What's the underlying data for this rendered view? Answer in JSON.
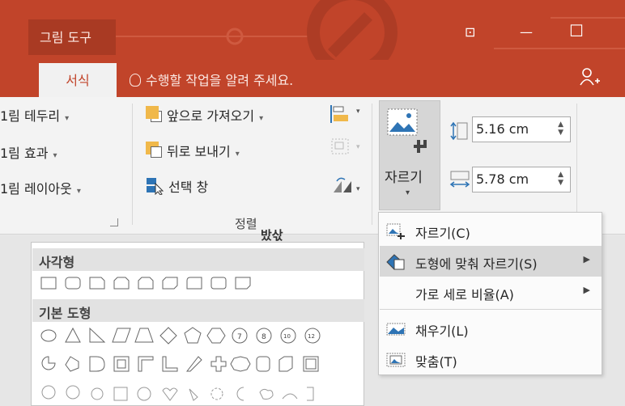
{
  "title_bar": {
    "tool_label": "그림 도구",
    "restore_glyph": "⊡",
    "minimize_glyph": "—",
    "maximize_glyph": "☐"
  },
  "tabs": {
    "active": "서식",
    "tell_me": "수행할 작업을 알려 주세요."
  },
  "ribbon": {
    "left_col": [
      "1림 테두리",
      "1림 효과",
      "1림 레이아웃"
    ],
    "arrange": {
      "bring_forward": "앞으로 가져오기",
      "send_backward": "뒤로 보내기",
      "selection_pane": "선택 창",
      "group_label": "정렬"
    },
    "crop_button": "자르기",
    "height_value": "5.16 cm",
    "width_value": "5.78 cm",
    "dropdown_glyph": "▾"
  },
  "peek_text": "밨삯",
  "gallery": {
    "headers": [
      "사각형",
      "기본 도형"
    ],
    "rect_count": 9,
    "basic_row1_labels": [
      "7",
      "8",
      "10",
      "12"
    ]
  },
  "menu": {
    "items": [
      {
        "label": "자르기(C)",
        "icon": "crop-icon",
        "submenu": false
      },
      {
        "label": "도형에 맞춰 자르기(S)",
        "icon": "crop-to-shape-icon",
        "submenu": true
      },
      {
        "label": "가로 세로 비율(A)",
        "icon": "",
        "submenu": true
      },
      {
        "label": "채우기(L)",
        "icon": "fill-icon",
        "submenu": false
      },
      {
        "label": "맞춤(T)",
        "icon": "fit-icon",
        "submenu": false
      }
    ],
    "submenu_glyph": "▶"
  },
  "colors": {
    "accent": "#c1442a",
    "accent_dark": "#a93a23",
    "ribbon_bg": "#f3f3f3",
    "menu_highlight": "#d8d8d8",
    "icon_blue": "#2e74b5",
    "icon_orange": "#f0b84a"
  }
}
